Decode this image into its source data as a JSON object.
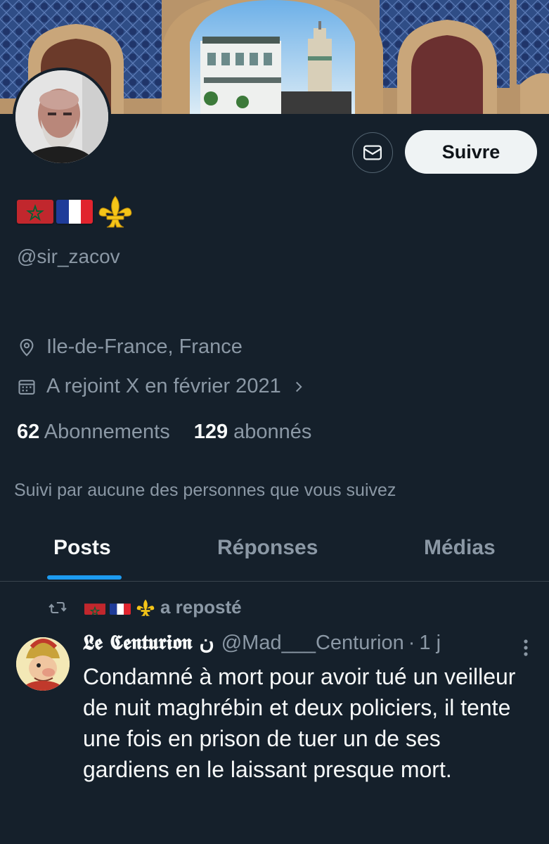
{
  "profile": {
    "display_name_flags": [
      "morocco-flag",
      "france-flag",
      "fleur-de-lis"
    ],
    "handle": "@sir_zacov",
    "location": "Ile-de-France, France",
    "joined": "A rejoint X en février 2021",
    "following_count": "62",
    "following_label": "Abonnements",
    "followers_count": "129",
    "followers_label": "abonnés",
    "followed_by": "Suivi par aucune des personnes que vous suivez"
  },
  "actions": {
    "message_icon": "mail-icon",
    "follow_label": "Suivre"
  },
  "tabs": [
    {
      "label": "Posts",
      "active": true
    },
    {
      "label": "Réponses",
      "active": false
    },
    {
      "label": "Médias",
      "active": false
    }
  ],
  "post": {
    "repost_label": "a reposté",
    "author_name": "𝕷𝖊 𝕮𝖊𝖓𝖙𝖚𝖗𝖎𝖔𝖓 ن",
    "author_handle": "@Mad___Centurion",
    "separator": "·",
    "time": "1 j",
    "text": "Condamné à mort pour avoir tué un veilleur de nuit maghrébin et deux policiers, il tente une fois en prison de tuer un de ses gardiens en le laissant presque mort."
  },
  "colors": {
    "background": "#15202b",
    "accent": "#1d9bf0",
    "secondary_text": "#8b98a5",
    "primary_text": "#f7f9f9"
  }
}
